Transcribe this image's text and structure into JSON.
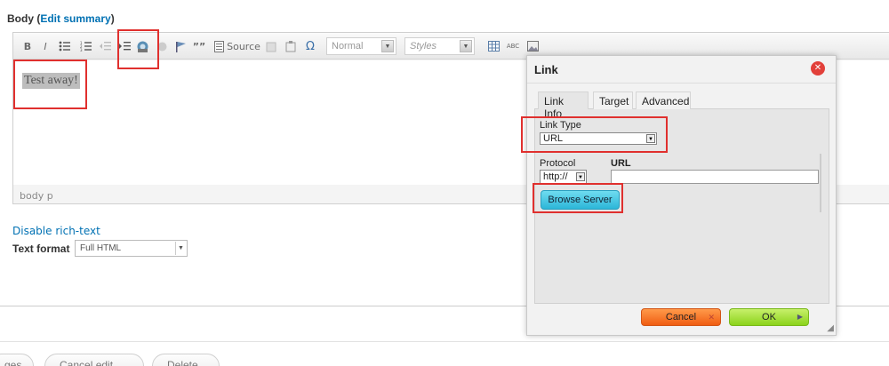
{
  "field": {
    "label": "Body",
    "link_text": "Edit summary"
  },
  "toolbar": {
    "bold": "B",
    "italic": "I",
    "quote": "””",
    "source": "Source",
    "omega": "Ω",
    "format_value": "Normal",
    "styles_placeholder": "Styles",
    "spell_label": "ABC"
  },
  "editor": {
    "content_text": "Test away!",
    "path": "body  p"
  },
  "below": {
    "disable_rich_text": "Disable rich-text",
    "text_format_label": "Text format",
    "text_format_value": "Full HTML"
  },
  "actions": {
    "save_partial": "ges",
    "cancel_edit": "Cancel edit",
    "delete": "Delete"
  },
  "dialog": {
    "title": "Link",
    "tabs": [
      "Link Info",
      "Target",
      "Advanced"
    ],
    "link_type_label": "Link Type",
    "link_type_value": "URL",
    "protocol_label": "Protocol",
    "protocol_value": "http://",
    "url_label": "URL",
    "url_value": "",
    "browse_server": "Browse Server",
    "cancel": "Cancel",
    "ok": "OK"
  },
  "colors": {
    "link": "#0071b3",
    "highlight": "#e0302e",
    "cancel_orange": "#f05d12",
    "ok_green": "#8bd31b",
    "browse_cyan": "#2cb6d8"
  }
}
